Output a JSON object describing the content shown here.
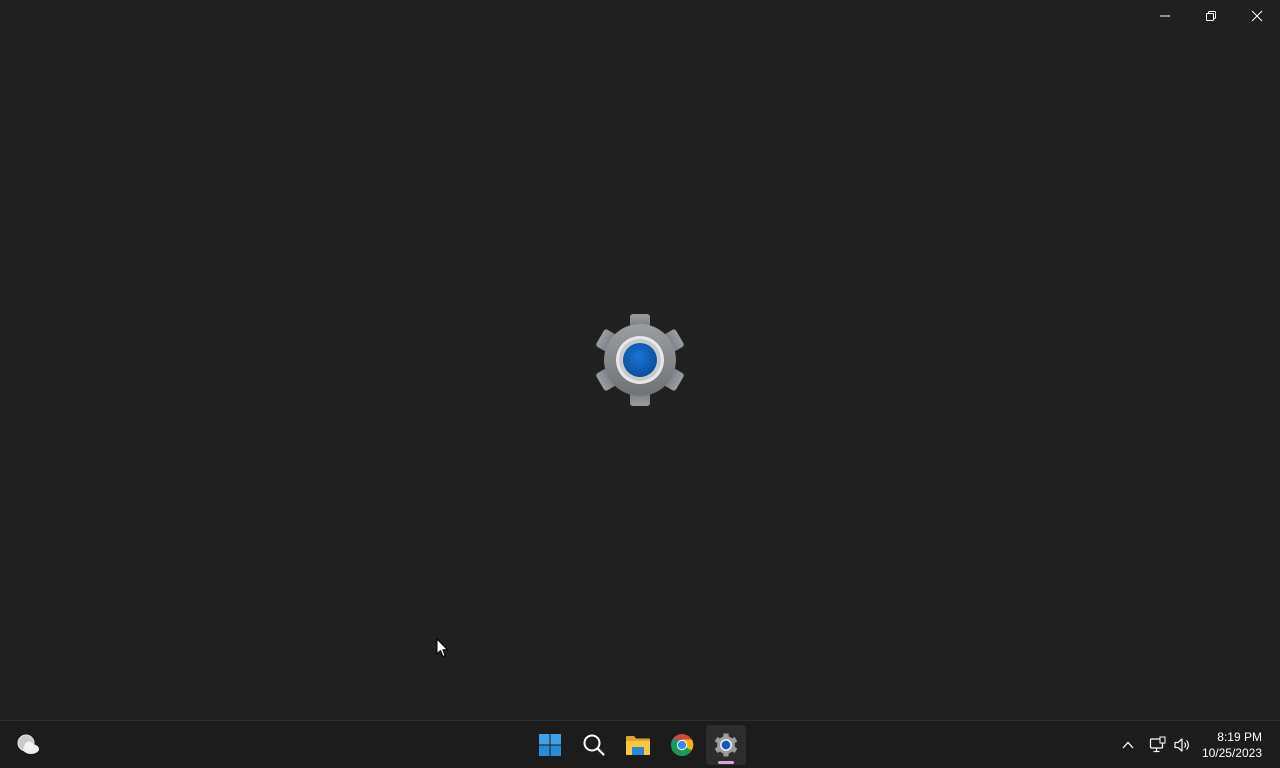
{
  "window": {
    "title": "Settings",
    "caption": {
      "minimize_icon": "minimize-icon",
      "restore_icon": "restore-icon",
      "close_icon": "close-icon"
    },
    "splash_icon": "settings-gear-icon"
  },
  "taskbar": {
    "widgets_icon": "weather-cloudy-icon",
    "apps": [
      {
        "icon": "windows-start-icon",
        "active": false
      },
      {
        "icon": "search-icon",
        "active": false
      },
      {
        "icon": "file-explorer-icon",
        "active": false
      },
      {
        "icon": "chrome-icon",
        "active": false
      },
      {
        "icon": "settings-gear-icon",
        "active": true
      }
    ],
    "tray": {
      "chevron_icon": "chevron-up-icon",
      "network_icon": "network-icon",
      "volume_icon": "volume-icon"
    },
    "clock": {
      "time": "8:19 PM",
      "date": "10/25/2023"
    }
  },
  "colors": {
    "background": "#202020",
    "taskbar": "#1c1c1c",
    "accent_blue": "#0f5bb5",
    "gear_gray": "#8a8d91",
    "active_indicator": "#d8a7d8"
  }
}
